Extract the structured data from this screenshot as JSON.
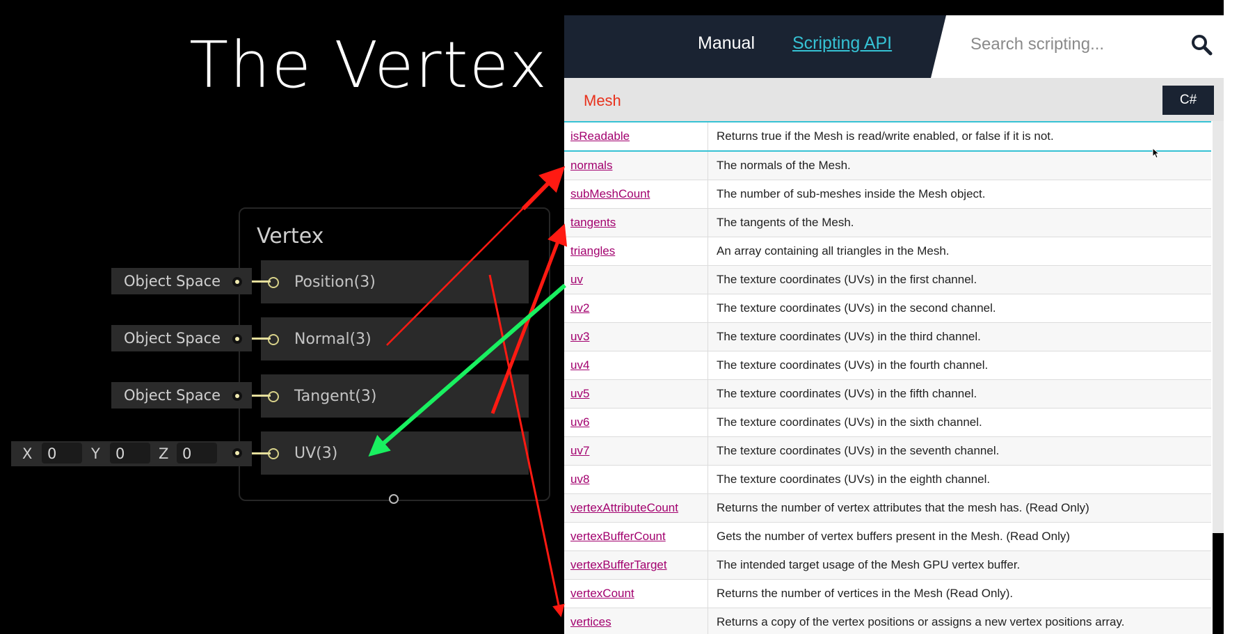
{
  "slide": {
    "title": "The Vertex E"
  },
  "node": {
    "title": "Vertex",
    "ports": [
      {
        "label": "Position(3)",
        "space": "Object Space"
      },
      {
        "label": "Normal(3)",
        "space": "Object Space"
      },
      {
        "label": "Tangent(3)",
        "space": "Object Space"
      },
      {
        "label": "UV(3)"
      }
    ],
    "uv_input": {
      "x_label": "X",
      "x_value": "0",
      "y_label": "Y",
      "y_value": "0",
      "z_label": "Z",
      "z_value": "0"
    }
  },
  "docs": {
    "nav": {
      "manual": "Manual",
      "scripting_api": "Scripting API",
      "search_placeholder": "Search scripting..."
    },
    "class_name": "Mesh",
    "language": "C#",
    "rows": [
      {
        "name": "isReadable",
        "desc": "Returns true if the Mesh is read/write enabled, or false if it is not."
      },
      {
        "name": "normals",
        "desc": "The normals of the Mesh."
      },
      {
        "name": "subMeshCount",
        "desc": "The number of sub-meshes inside the Mesh object."
      },
      {
        "name": "tangents",
        "desc": "The tangents of the Mesh."
      },
      {
        "name": "triangles",
        "desc": "An array containing all triangles in the Mesh."
      },
      {
        "name": "uv",
        "desc": "The texture coordinates (UVs) in the first channel."
      },
      {
        "name": "uv2",
        "desc": "The texture coordinates (UVs) in the second channel."
      },
      {
        "name": "uv3",
        "desc": "The texture coordinates (UVs) in the third channel."
      },
      {
        "name": "uv4",
        "desc": "The texture coordinates (UVs) in the fourth channel."
      },
      {
        "name": "uv5",
        "desc": "The texture coordinates (UVs) in the fifth channel."
      },
      {
        "name": "uv6",
        "desc": "The texture coordinates (UVs) in the sixth channel."
      },
      {
        "name": "uv7",
        "desc": "The texture coordinates (UVs) in the seventh channel."
      },
      {
        "name": "uv8",
        "desc": "The texture coordinates (UVs) in the eighth channel."
      },
      {
        "name": "vertexAttributeCount",
        "desc": "Returns the number of vertex attributes that the mesh has. (Read Only)"
      },
      {
        "name": "vertexBufferCount",
        "desc": "Gets the number of vertex buffers present in the Mesh. (Read Only)"
      },
      {
        "name": "vertexBufferTarget",
        "desc": "The intended target usage of the Mesh GPU vertex buffer."
      },
      {
        "name": "vertexCount",
        "desc": "Returns the number of vertices in the Mesh (Read Only)."
      },
      {
        "name": "vertices",
        "desc": "Returns a copy of the vertex positions or assigns a new vertex positions array."
      }
    ]
  },
  "colors": {
    "annotation_red": "#ff1a12",
    "annotation_green": "#19f060",
    "link": "#a2006e",
    "accent": "#36c2d4",
    "header_dark": "#1a2332"
  }
}
